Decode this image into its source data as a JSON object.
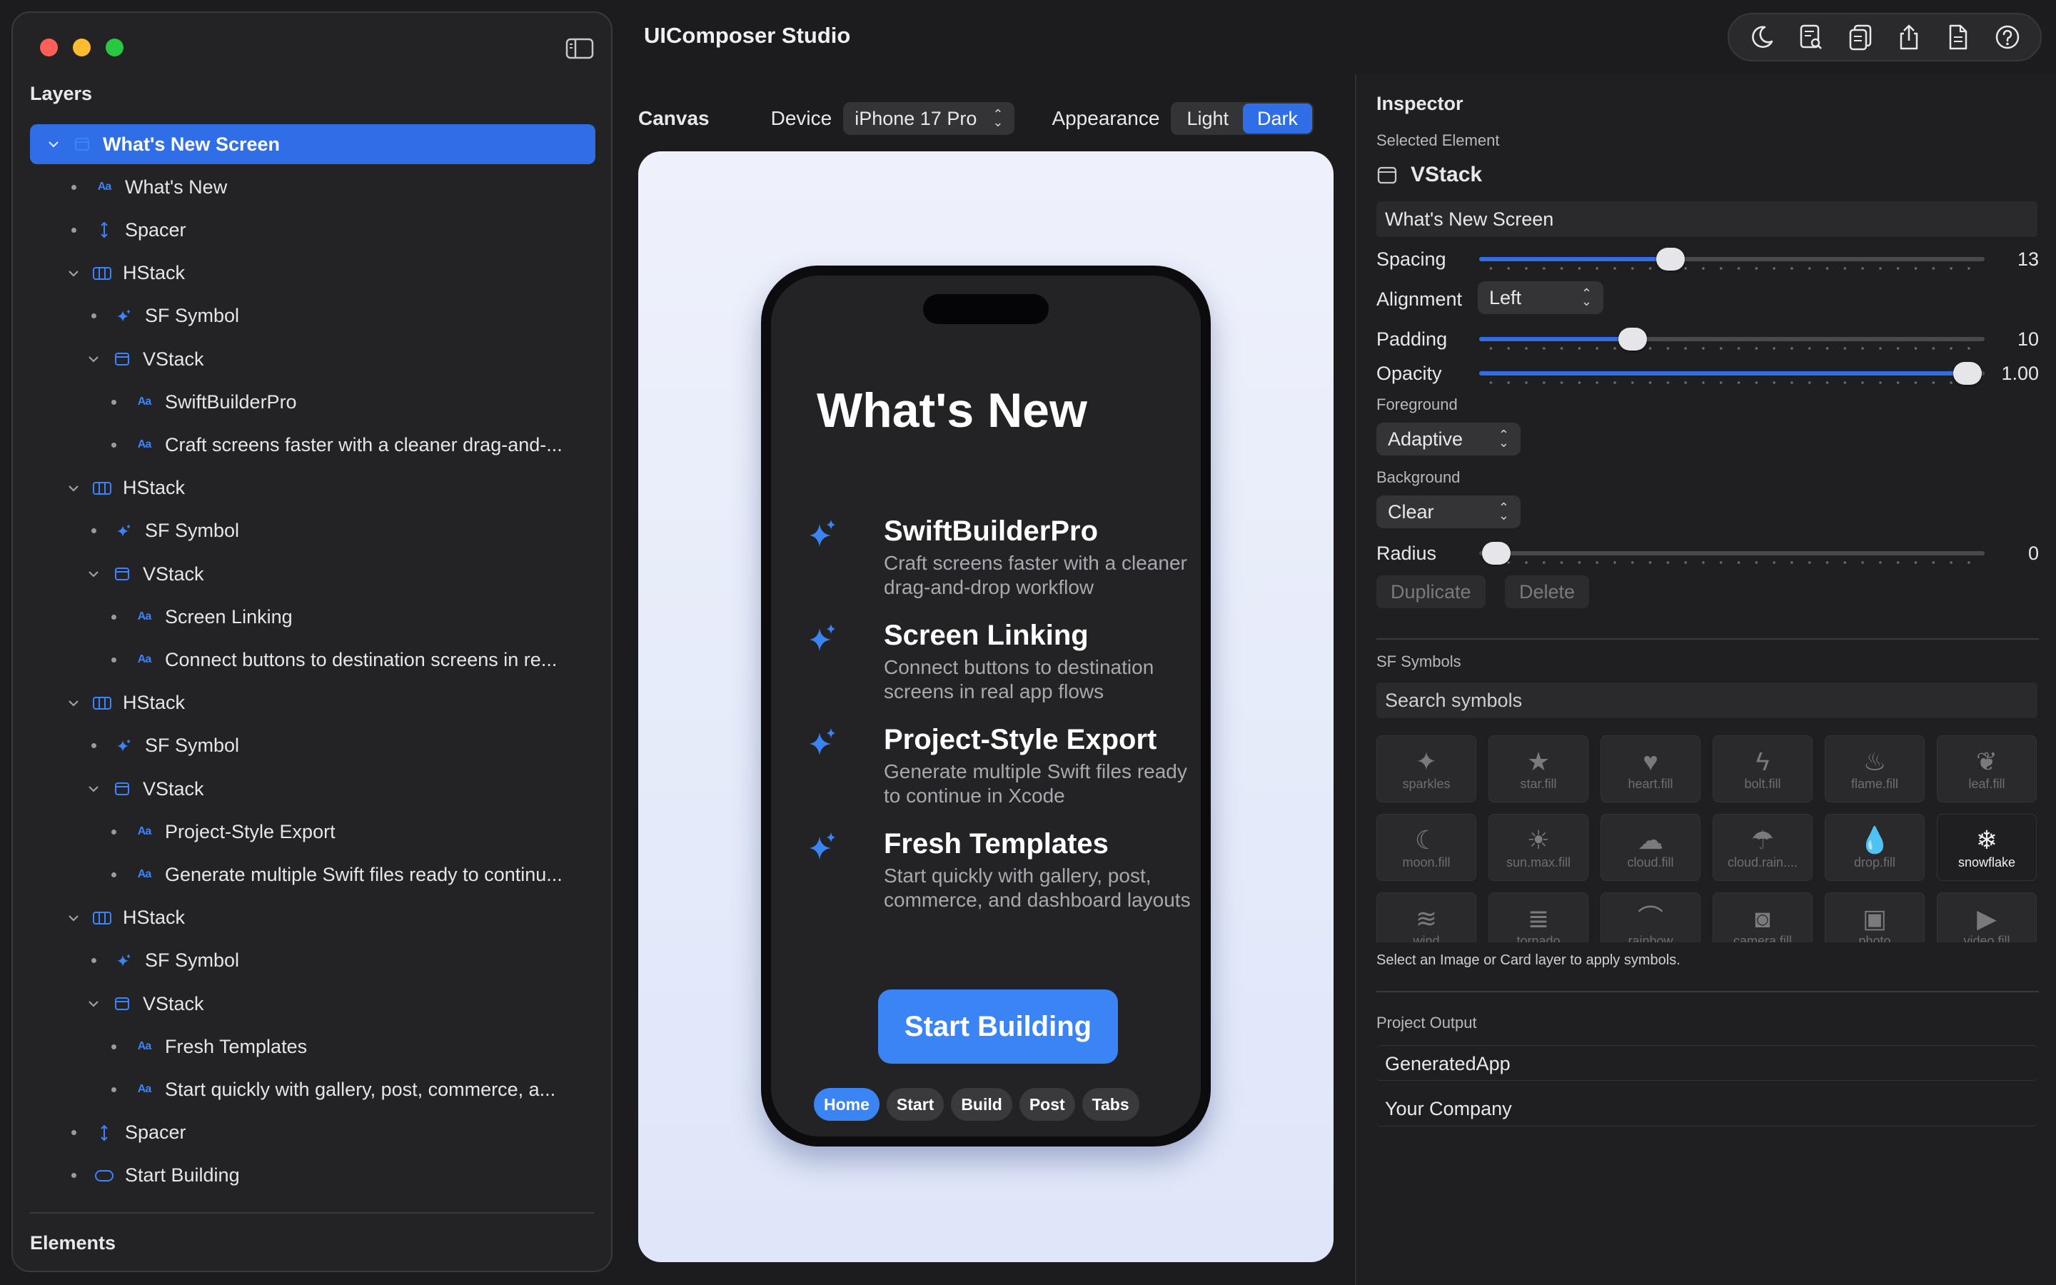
{
  "app": {
    "title": "UIComposer Studio"
  },
  "sidebar": {
    "layers_title": "Layers",
    "elements_title": "Elements",
    "layers": [
      {
        "label": "What's New Screen",
        "icon": "vstack-icon",
        "selected": true
      },
      {
        "label": "What's New",
        "icon": "text-icon"
      },
      {
        "label": "Spacer",
        "icon": "spacer-icon"
      },
      {
        "label": "HStack",
        "icon": "hstack-icon"
      },
      {
        "label": "SF Symbol",
        "icon": "sparkles-icon"
      },
      {
        "label": "VStack",
        "icon": "vstack-icon"
      },
      {
        "label": "SwiftBuilderPro",
        "icon": "text-icon"
      },
      {
        "label": "Craft screens faster with a cleaner drag-and-...",
        "icon": "text-icon"
      },
      {
        "label": "HStack",
        "icon": "hstack-icon"
      },
      {
        "label": "SF Symbol",
        "icon": "sparkles-icon"
      },
      {
        "label": "VStack",
        "icon": "vstack-icon"
      },
      {
        "label": "Screen Linking",
        "icon": "text-icon"
      },
      {
        "label": "Connect buttons to destination screens in re...",
        "icon": "text-icon"
      },
      {
        "label": "HStack",
        "icon": "hstack-icon"
      },
      {
        "label": "SF Symbol",
        "icon": "sparkles-icon"
      },
      {
        "label": "VStack",
        "icon": "vstack-icon"
      },
      {
        "label": "Project-Style Export",
        "icon": "text-icon"
      },
      {
        "label": "Generate multiple Swift files ready to continu...",
        "icon": "text-icon"
      },
      {
        "label": "HStack",
        "icon": "hstack-icon"
      },
      {
        "label": "SF Symbol",
        "icon": "sparkles-icon"
      },
      {
        "label": "VStack",
        "icon": "vstack-icon"
      },
      {
        "label": "Fresh Templates",
        "icon": "text-icon"
      },
      {
        "label": "Start quickly with gallery, post, commerce, a...",
        "icon": "text-icon"
      },
      {
        "label": "Spacer",
        "icon": "spacer-icon"
      },
      {
        "label": "Start Building",
        "icon": "capsule-icon"
      }
    ]
  },
  "toolbar": {
    "icons": [
      "moon-icon",
      "inspect-doc-icon",
      "duplicate-doc-icon",
      "share-icon",
      "document-icon",
      "help-icon"
    ]
  },
  "canvas": {
    "label": "Canvas",
    "device_label": "Device",
    "device_value": "iPhone 17 Pro",
    "appearance_label": "Appearance",
    "appearance_options": [
      "Light",
      "Dark"
    ],
    "appearance_selected": "Dark"
  },
  "preview": {
    "title": "What's New",
    "features": [
      {
        "title": "SwiftBuilderPro",
        "desc": "Craft screens faster with a cleaner drag-and-drop workflow"
      },
      {
        "title": "Screen Linking",
        "desc": "Connect buttons to destination screens in real app flows"
      },
      {
        "title": "Project-Style Export",
        "desc": "Generate multiple Swift files ready to continue in Xcode"
      },
      {
        "title": "Fresh Templates",
        "desc": "Start quickly with gallery, post, commerce, and dashboard layouts"
      }
    ],
    "cta": "Start Building",
    "tabs": [
      "Home",
      "Start",
      "Build",
      "Post",
      "Tabs"
    ],
    "active_tab": "Home"
  },
  "inspector": {
    "title": "Inspector",
    "selected_label": "Selected Element",
    "element_type": "VStack",
    "element_name": "What's New Screen",
    "spacing": {
      "label": "Spacing",
      "value": "13",
      "fraction": 0.37
    },
    "alignment": {
      "label": "Alignment",
      "value": "Left"
    },
    "padding": {
      "label": "Padding",
      "value": "10",
      "fraction": 0.29
    },
    "opacity": {
      "label": "Opacity",
      "value": "1.00",
      "fraction": 1.0
    },
    "foreground": {
      "label": "Foreground",
      "value": "Adaptive"
    },
    "background": {
      "label": "Background",
      "value": "Clear"
    },
    "radius": {
      "label": "Radius",
      "value": "0",
      "fraction": 0.0
    },
    "duplicate": "Duplicate",
    "delete": "Delete",
    "symbols_title": "SF Symbols",
    "symbols_placeholder": "Search symbols",
    "symbols": [
      {
        "name": "sparkles",
        "glyph": "✦"
      },
      {
        "name": "star.fill",
        "glyph": "★"
      },
      {
        "name": "heart.fill",
        "glyph": "♥"
      },
      {
        "name": "bolt.fill",
        "glyph": "ϟ"
      },
      {
        "name": "flame.fill",
        "glyph": "♨"
      },
      {
        "name": "leaf.fill",
        "glyph": "❦"
      },
      {
        "name": "moon.fill",
        "glyph": "☾"
      },
      {
        "name": "sun.max.fill",
        "glyph": "☀"
      },
      {
        "name": "cloud.fill",
        "glyph": "☁"
      },
      {
        "name": "cloud.rain....",
        "glyph": "☂"
      },
      {
        "name": "drop.fill",
        "glyph": "💧"
      },
      {
        "name": "snowflake",
        "glyph": "❄"
      },
      {
        "name": "wind",
        "glyph": "≋"
      },
      {
        "name": "tornado",
        "glyph": "≣"
      },
      {
        "name": "rainbow",
        "glyph": "⌒"
      },
      {
        "name": "camera.fill",
        "glyph": "◙"
      },
      {
        "name": "photo",
        "glyph": "▣"
      },
      {
        "name": "video.fill",
        "glyph": "▶"
      }
    ],
    "symbols_selected": "snowflake",
    "symbols_hint": "Select an Image or Card layer to apply symbols.",
    "output_title": "Project Output",
    "output_app": "GeneratedApp",
    "output_company": "Your Company"
  },
  "colors": {
    "accent": "#2f6ee6",
    "button": "#3a84f5",
    "window_bg": "#1c1c1e",
    "preview_bg": "#e6ebfa"
  }
}
